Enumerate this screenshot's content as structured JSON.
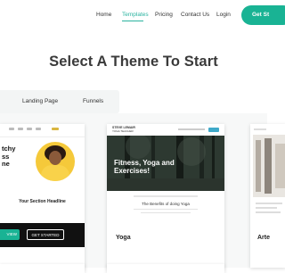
{
  "nav": {
    "items": [
      {
        "label": "Home",
        "active": false
      },
      {
        "label": "Templates",
        "active": true
      },
      {
        "label": "Pricing",
        "active": false
      },
      {
        "label": "Contact Us",
        "active": false
      },
      {
        "label": "Login",
        "active": false
      }
    ],
    "cta_label": "Get St"
  },
  "heading": "Select A Theme To Start",
  "filters": [
    {
      "label": "Landing Page"
    },
    {
      "label": "Funnels"
    }
  ],
  "cards": [
    {
      "name": "",
      "preview": {
        "headline_lines": [
          "tchy",
          "ss",
          "ne"
        ],
        "section_headline": "Your Section Headline",
        "primary_button": "VIEW",
        "secondary_button": "GET STARTED"
      }
    },
    {
      "name": "Yoga",
      "preview": {
        "brand": "STEVE LEMAIR",
        "brand_sub": "YOGA TEACHER",
        "hero_title_lines": [
          "Fitness, Yoga and",
          "Exercises!"
        ],
        "subtitle": "The Benefits of doing Yoga"
      }
    },
    {
      "name": "Arte"
    }
  ],
  "colors": {
    "accent": "#2bb3a0",
    "cta": "#19b394",
    "heading": "#3a3a3a",
    "card1_accent": "#f5c93a"
  }
}
